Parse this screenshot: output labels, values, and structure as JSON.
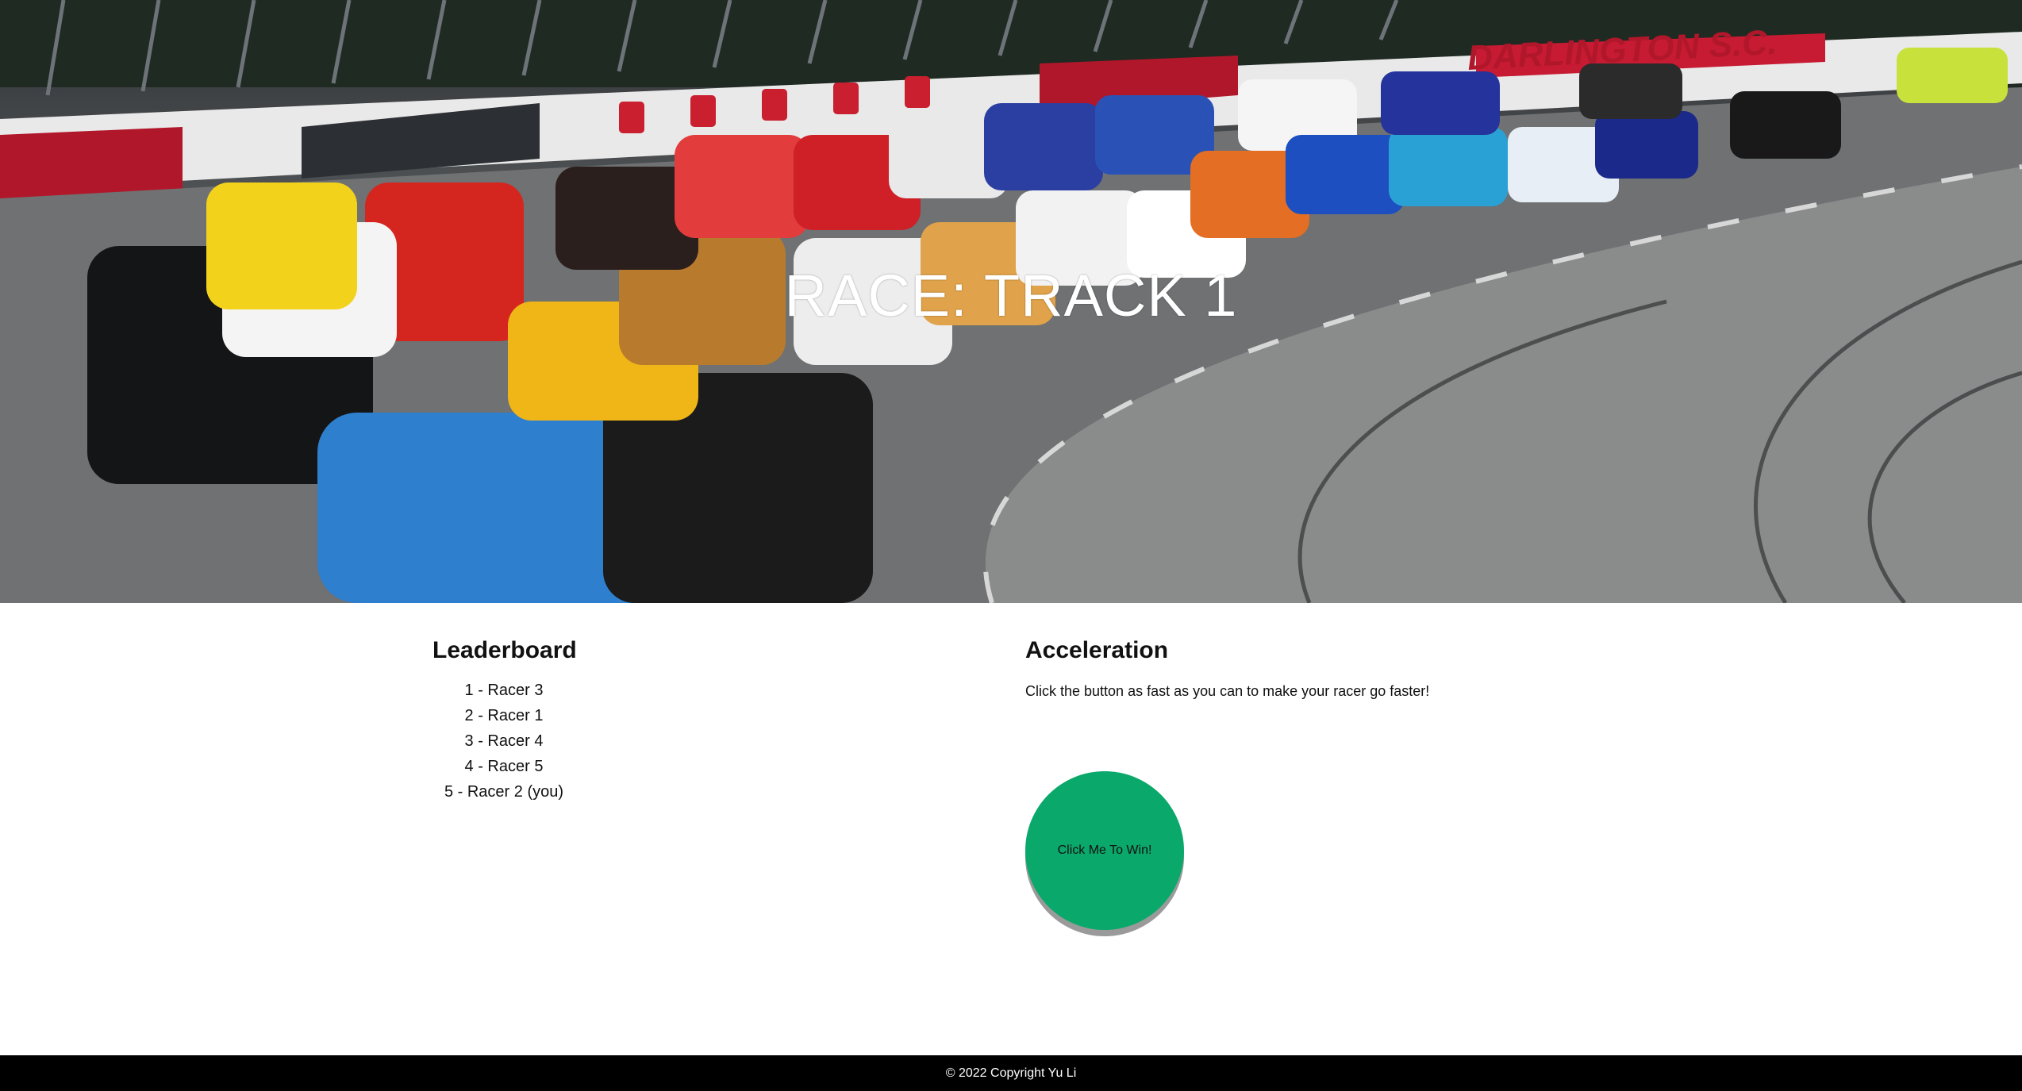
{
  "hero": {
    "title": "RACE: TRACK 1",
    "image_alt": "Stock cars racing on an oval track",
    "banner_text": "DARLINGTON S.C."
  },
  "leaderboard": {
    "heading": "Leaderboard",
    "entries": [
      "1 - Racer 3",
      "2 - Racer 1",
      "3 - Racer 4",
      "4 - Racer 5",
      "5 - Racer 2 (you)"
    ]
  },
  "acceleration": {
    "heading": "Acceleration",
    "description": "Click the button as fast as you can to make your racer go faster!",
    "button_label": "Click Me To Win!"
  },
  "footer": {
    "copyright": "© 2022 Copyright Yu Li"
  },
  "colors": {
    "button": "#0aa86a",
    "footer_bg": "#000000",
    "hero_text": "#ffffff"
  }
}
